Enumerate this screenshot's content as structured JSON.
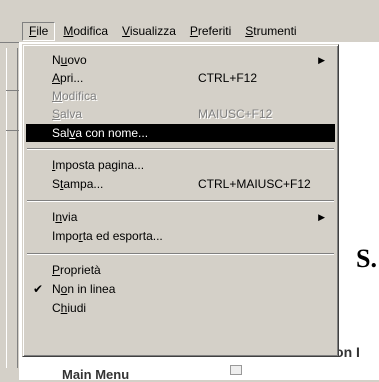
{
  "menubar": {
    "items": [
      {
        "pre": "",
        "u": "F",
        "post": "ile"
      },
      {
        "pre": "",
        "u": "M",
        "post": "odifica"
      },
      {
        "pre": "",
        "u": "V",
        "post": "isualizza"
      },
      {
        "pre": "",
        "u": "P",
        "post": "referiti"
      },
      {
        "pre": "",
        "u": "S",
        "post": "trumenti"
      }
    ]
  },
  "file_menu": {
    "nuovo": {
      "pre": "N",
      "u": "u",
      "post": "ovo"
    },
    "apri": {
      "pre": "",
      "u": "A",
      "post": "pri...",
      "shortcut": "CTRL+F12"
    },
    "modifica": {
      "pre": "",
      "u": "M",
      "post": "odifica"
    },
    "salva": {
      "pre": "",
      "u": "S",
      "post": "alva",
      "shortcut": "MAIUSC+F12"
    },
    "salva_con_nome": {
      "pre": "Sal",
      "u": "v",
      "post": "a con nome..."
    },
    "imposta_pagina": {
      "pre": "",
      "u": "I",
      "post": "mposta pagina..."
    },
    "stampa": {
      "pre": "S",
      "u": "t",
      "post": "ampa...",
      "shortcut": "CTRL+MAIUSC+F12"
    },
    "invia": {
      "pre": "I",
      "u": "n",
      "post": "via"
    },
    "importa": {
      "pre": "Impo",
      "u": "r",
      "post": "ta ed esporta..."
    },
    "proprieta": {
      "pre": "",
      "u": "P",
      "post": "roprietà"
    },
    "non_in_linea": {
      "pre": "N",
      "u": "o",
      "post": "n in linea",
      "check": "✔"
    },
    "chiudi": {
      "pre": "C",
      "u": "h",
      "post": "iudi"
    }
  },
  "page": {
    "main_menu_label": "Main Menu",
    "partial_label": "Sermon I",
    "big_char": "S."
  }
}
